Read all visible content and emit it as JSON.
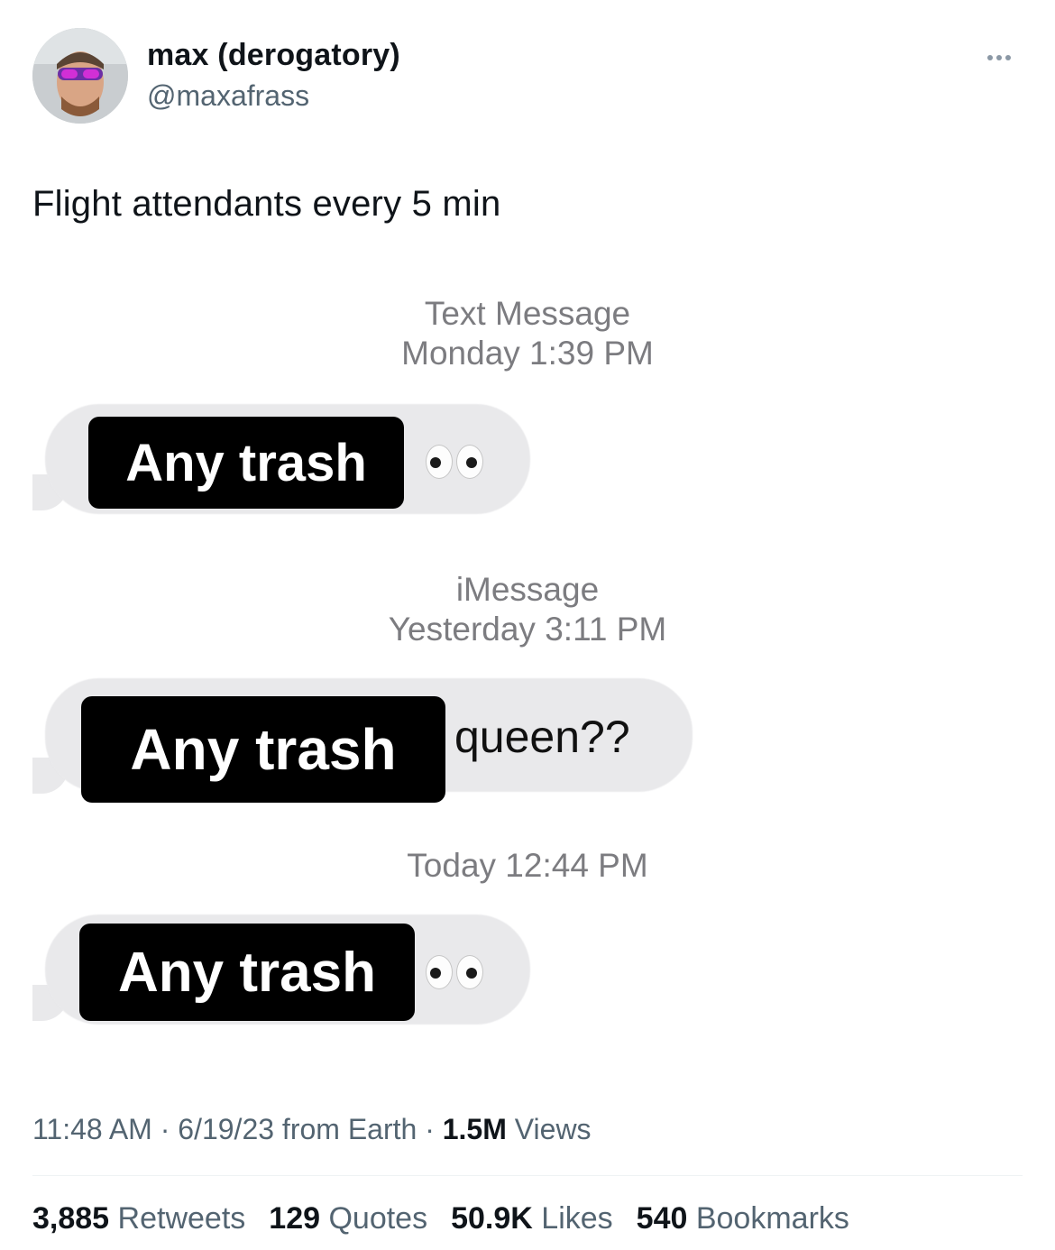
{
  "author": {
    "display_name": "max (derogatory)",
    "handle": "@maxafrass"
  },
  "tweet": {
    "text": "Flight attendants every 5 min"
  },
  "media": {
    "messages": [
      {
        "timestamp_line1": "Text Message",
        "timestamp_line2": "Monday 1:39 PM",
        "redacted_text": "Any trash",
        "suffix_text": "",
        "emoji": "eyes-emoji"
      },
      {
        "timestamp_line1": "iMessage",
        "timestamp_line2": "Yesterday 3:11 PM",
        "redacted_text": "Any trash",
        "suffix_text": "queen??",
        "emoji": ""
      },
      {
        "timestamp_line1": "Today 12:44 PM",
        "timestamp_line2": "",
        "redacted_text": "Any trash",
        "suffix_text": "",
        "emoji": "eyes-emoji"
      }
    ]
  },
  "meta": {
    "time": "11:48 AM",
    "sep1": " · ",
    "date": "6/19/23",
    "source": " from Earth",
    "sep2": " · ",
    "views_count": "1.5M",
    "views_label": " Views"
  },
  "stats": {
    "retweets_count": "3,885",
    "retweets_label": "Retweets",
    "quotes_count": "129",
    "quotes_label": "Quotes",
    "likes_count": "50.9K",
    "likes_label": "Likes",
    "bookmarks_count": "540",
    "bookmarks_label": "Bookmarks"
  },
  "colors": {
    "text_primary": "#0f1419",
    "text_secondary": "#536471",
    "bubble_gray": "#e9e9eb",
    "redaction": "#000000"
  }
}
